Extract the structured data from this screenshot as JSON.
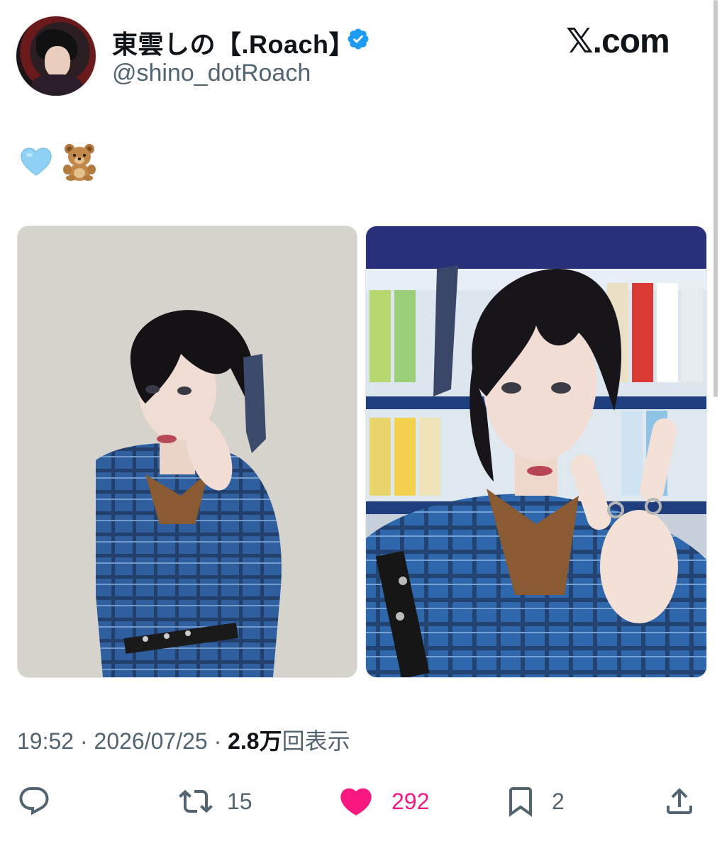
{
  "author": {
    "display_name": "東雲しの【.Roach】",
    "handle": "@shino_dotRoach",
    "verified": true,
    "verified_color": "#1d9bf0"
  },
  "brand": {
    "label": "𝕏.com"
  },
  "tweet": {
    "emojis": [
      "light-blue-heart-emoji",
      "teddy-bear-emoji"
    ],
    "media": [
      {
        "name": "photo-1"
      },
      {
        "name": "photo-2"
      }
    ]
  },
  "meta": {
    "time": "19:52",
    "separator": " · ",
    "date": "2026/07/25",
    "views_count": "2.8",
    "views_unit": "万",
    "views_label": "回表示"
  },
  "actions": {
    "reply_icon": "reply-icon",
    "retweet_count": "15",
    "like_count": "292",
    "like_color": "#f91880",
    "bookmark_count": "2",
    "share_icon": "share-icon"
  }
}
